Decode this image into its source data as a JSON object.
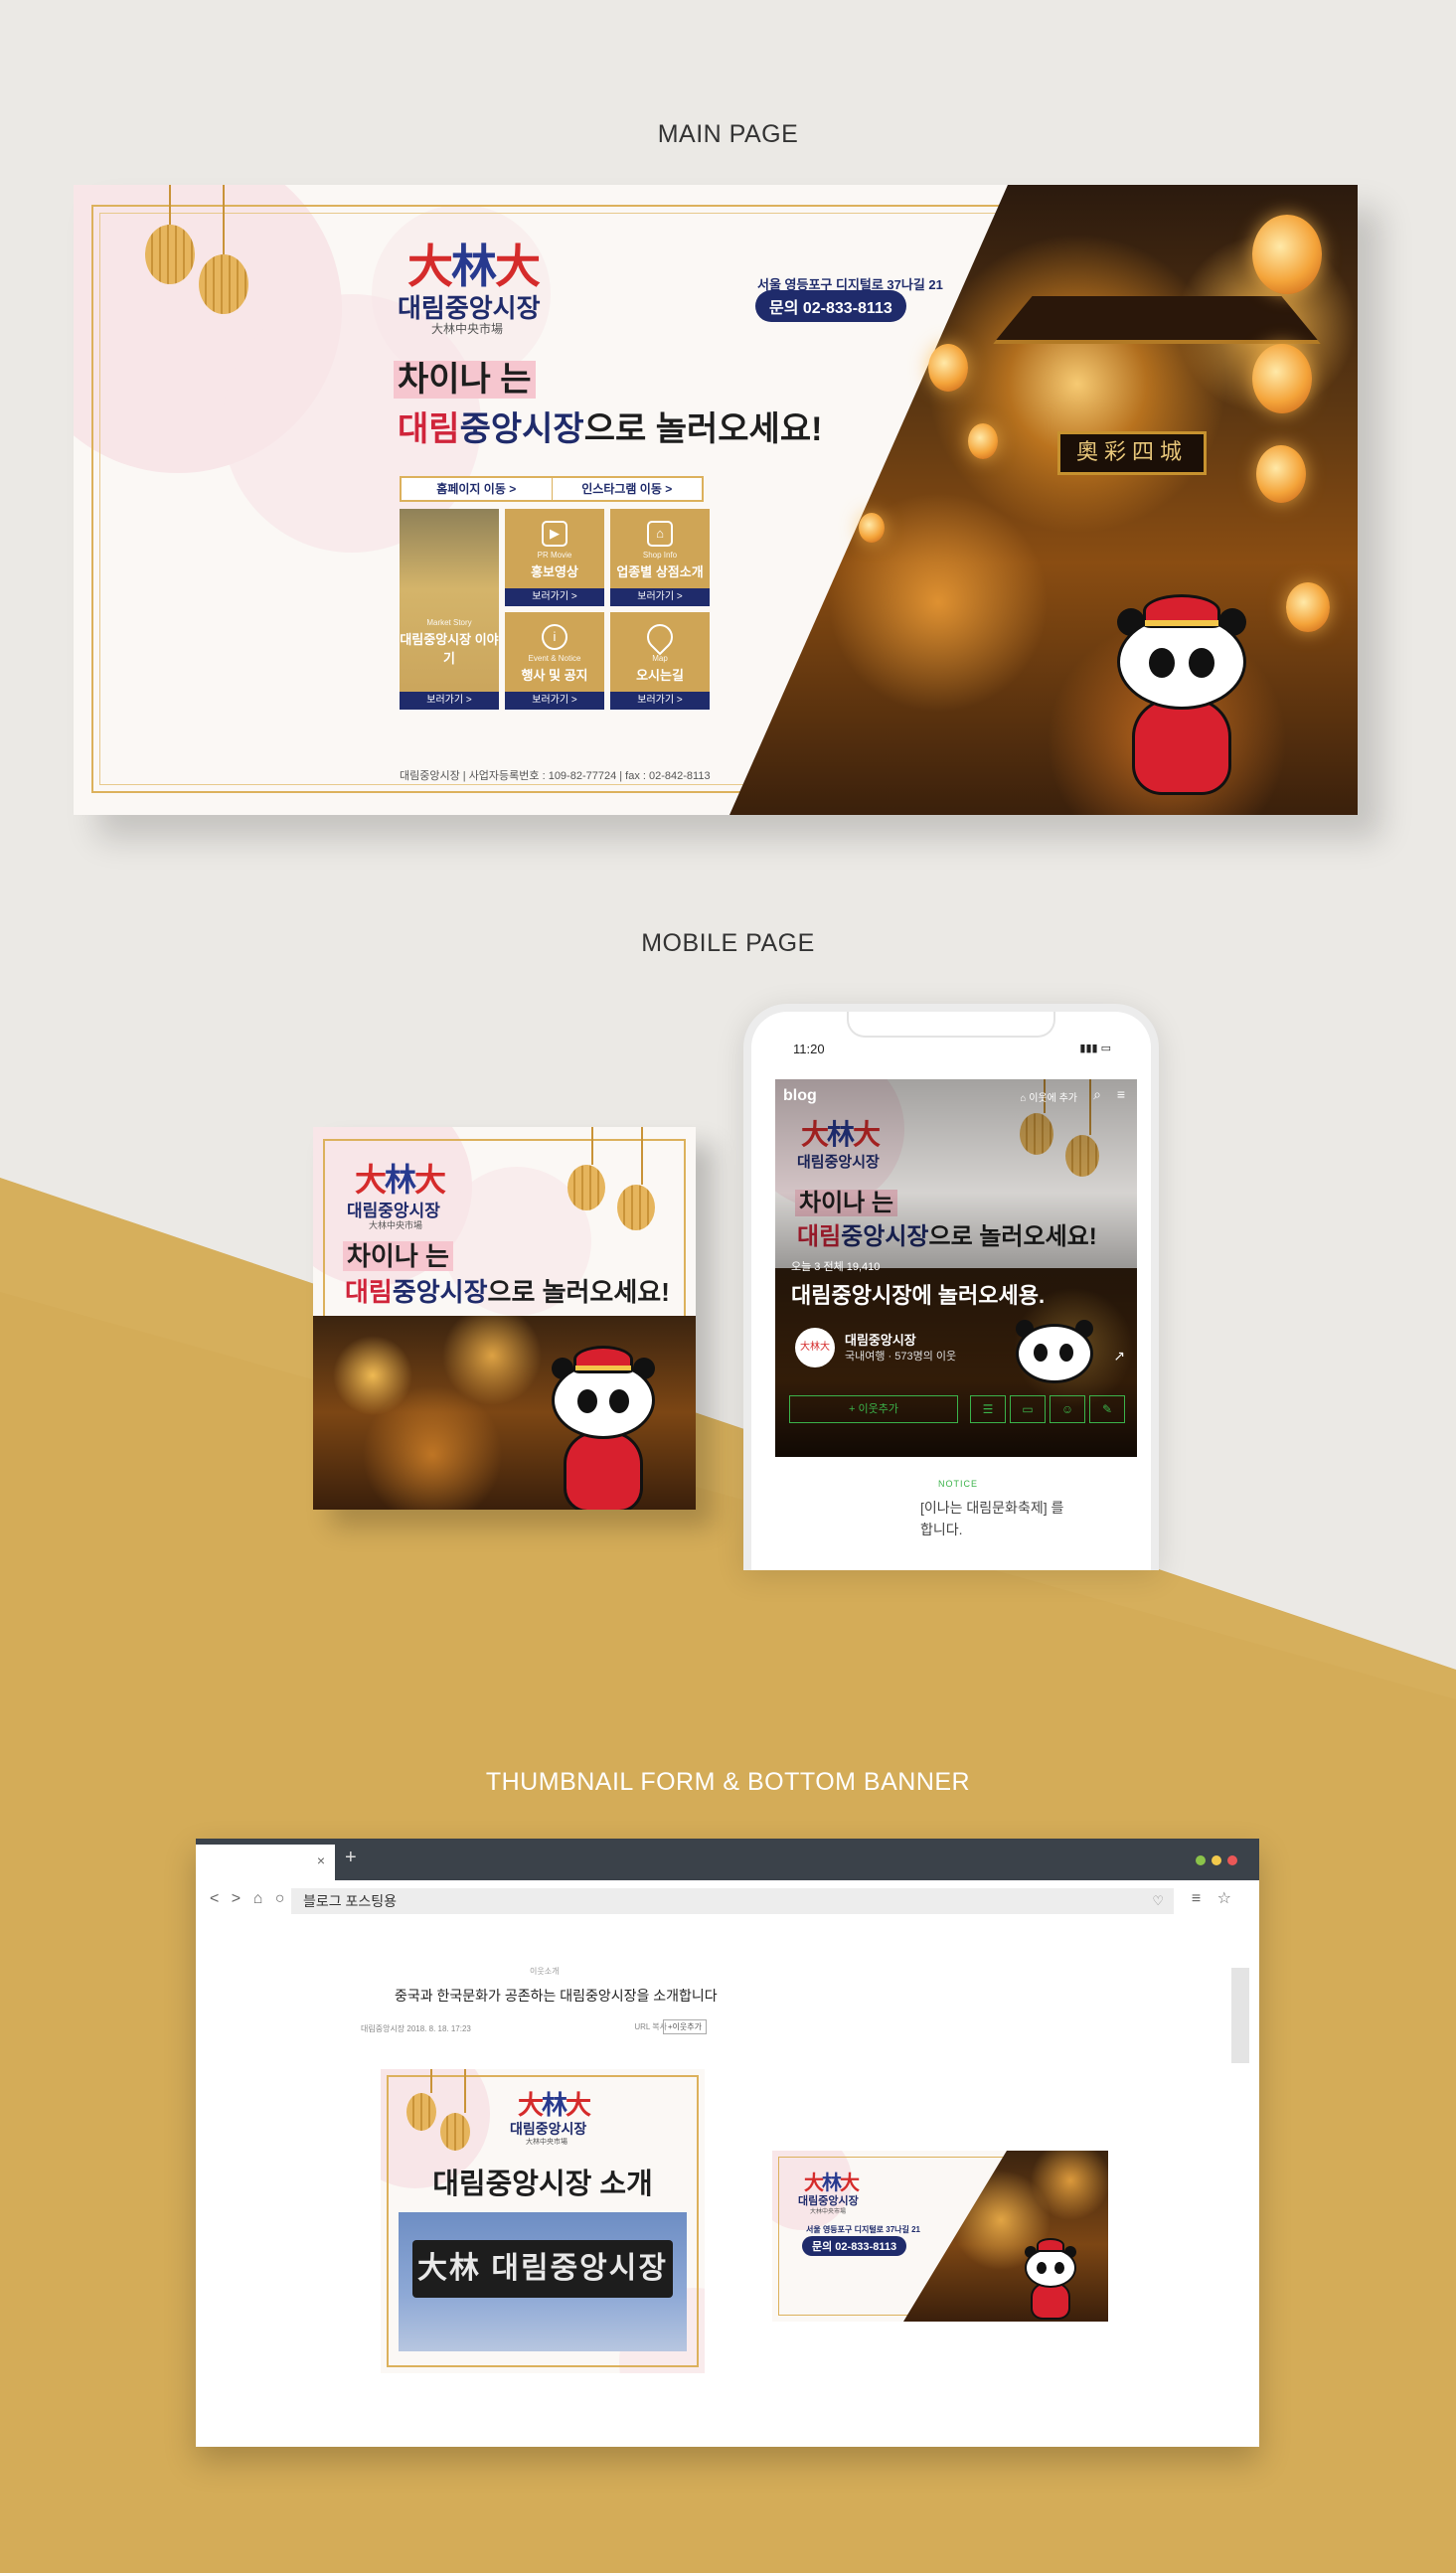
{
  "sections": {
    "main": "MAIN PAGE",
    "mobile": "MOBILE PAGE",
    "thumb": "THUMBNAIL FORM & BOTTOM BANNER"
  },
  "brand": {
    "logo_mark": "大林大",
    "name_ko": "대림중앙시장",
    "name_cn": "大林中央市場"
  },
  "banner": {
    "headline_1": "차이나 는",
    "headline_2_red": "대림",
    "headline_2_blue": "중앙시장",
    "headline_2_rest": "으로 놀러오세요!",
    "address": "서울 영등포구 디지털로 37나길 21",
    "phone": "문의 02-833-8113",
    "tab_home": "홈페이지 이동 >",
    "tab_insta": "인스타그램 이동 >",
    "tiles": [
      {
        "en": "Market Story",
        "ko": "대림중앙시장 이야기",
        "go": "보러가기 >"
      },
      {
        "en": "PR Movie",
        "ko": "홍보영상",
        "go": "보러가기 >"
      },
      {
        "en": "Shop Info",
        "ko": "업종별 상점소개",
        "go": "보러가기 >"
      },
      {
        "en": "Event & Notice",
        "ko": "행사 및 공지",
        "go": "보러가기 >"
      },
      {
        "en": "Map",
        "ko": "오시는길",
        "go": "보러가기 >"
      }
    ],
    "footer": "대림중앙시장 | 사업자등록번호 : 109-82-77724 | fax : 02-842-8113",
    "temple_sign": "奧彩四城"
  },
  "phone": {
    "time": "11:20",
    "status": "▮▮▮ ▭",
    "blog_logo": "blog",
    "add_button": "⌂ 이웃에 추가",
    "counter": "오늘 3   전체 19,410",
    "blog_title": "대림중앙시장에 놀러오세용.",
    "profile_name": "대림중앙시장",
    "profile_meta": "국내여행 · 573명의 이웃",
    "neighbor_btn": "+ 이웃추가",
    "notice_label": "NOTICE",
    "notice_text_1": "[이나는 대림문화축제] 를",
    "notice_text_2": "합니다."
  },
  "browser": {
    "url": "블로그 포스팅용",
    "nav_left": "< > ⌂ ○",
    "nav_right": "≡ ☆",
    "tab_close": "×",
    "tab_new": "+",
    "post_category": "이웃소개",
    "post_title": "중국과 한국문화가 공존하는 대림중앙시장을 소개합니다",
    "post_author": "대림중앙시장  2018. 8. 18. 17:23",
    "post_url": "URL 복사",
    "post_neighbor": "+이웃추가",
    "thumb_title": "대림중앙시장 소개",
    "sign_text": "大林 대림중앙시장",
    "bottom_address": "서울 영등포구 디지털로 37나길 21",
    "bottom_phone": "문의 02-833-8113"
  },
  "colors": {
    "gold": "#d4ac58",
    "navy": "#1f2b6b",
    "red": "#d0243a",
    "dot_green": "#8bc34a",
    "dot_yellow": "#f2c94c",
    "dot_red": "#eb5757"
  }
}
